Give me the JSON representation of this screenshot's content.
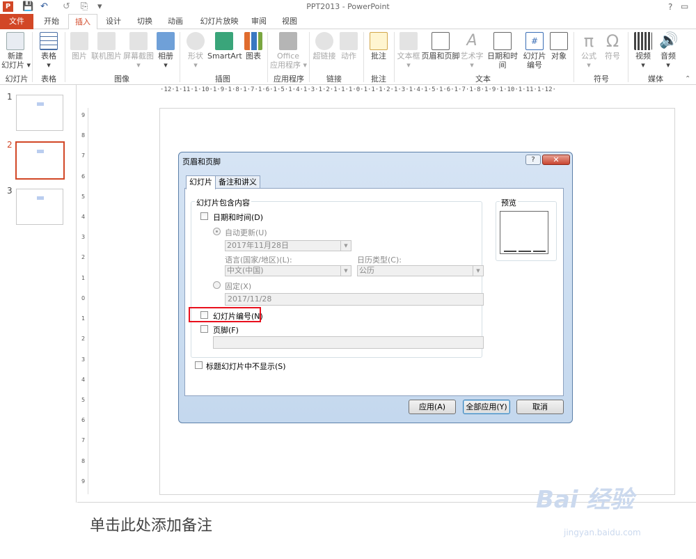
{
  "app": {
    "title": "PPT2013 - PowerPoint",
    "help": "?"
  },
  "qat": {
    "save": "💾",
    "undo": "↶",
    "redo": "↺",
    "more": "▾"
  },
  "tabs": [
    "文件",
    "开始",
    "插入",
    "设计",
    "切换",
    "动画",
    "幻灯片放映",
    "审阅",
    "视图"
  ],
  "ribbon": {
    "buttons": [
      {
        "label": "新建\n幻灯片 ▾",
        "disabled": false
      },
      {
        "label": "表格\n▾",
        "disabled": false
      },
      {
        "label": "图片",
        "disabled": true
      },
      {
        "label": "联机图片",
        "disabled": true
      },
      {
        "label": "屏幕截图\n▾",
        "disabled": true
      },
      {
        "label": "相册\n▾",
        "disabled": false
      },
      {
        "label": "形状\n▾",
        "disabled": true
      },
      {
        "label": "SmartArt",
        "disabled": false
      },
      {
        "label": "图表",
        "disabled": false
      },
      {
        "label": "Office\n应用程序 ▾",
        "disabled": true
      },
      {
        "label": "超链接",
        "disabled": true
      },
      {
        "label": "动作",
        "disabled": true
      },
      {
        "label": "批注",
        "disabled": false
      },
      {
        "label": "文本框\n▾",
        "disabled": true
      },
      {
        "label": "页眉和页脚",
        "disabled": false
      },
      {
        "label": "艺术字\n▾",
        "disabled": true
      },
      {
        "label": "日期和时间",
        "disabled": false
      },
      {
        "label": "幻灯片\n编号",
        "disabled": false
      },
      {
        "label": "对象",
        "disabled": false
      },
      {
        "label": "公式\n▾",
        "disabled": true
      },
      {
        "label": "符号",
        "disabled": true
      },
      {
        "label": "视频\n▾",
        "disabled": false
      },
      {
        "label": "音频\n▾",
        "disabled": false
      }
    ],
    "groups": [
      "幻灯片",
      "表格",
      "图像",
      "插图",
      "应用程序",
      "链接",
      "批注",
      "文本",
      "符号",
      "媒体"
    ]
  },
  "ruler": {
    "horizontal": "·12·1·11·1·10·1·9·1·8·1·7·1·6·1·5·1·4·1·3·1·2·1·1·1·0·1·1·1·2·1·3·1·4·1·5·1·6·1·7·1·8·1·9·1·10·1·11·1·12·",
    "vertical": [
      "9",
      "8",
      "7",
      "6",
      "5",
      "4",
      "3",
      "2",
      "1",
      "0",
      "1",
      "2",
      "3",
      "4",
      "5",
      "6",
      "7",
      "8",
      "9"
    ]
  },
  "slides": [
    {
      "num": "1"
    },
    {
      "num": "2"
    },
    {
      "num": "3"
    }
  ],
  "notes": {
    "placeholder": "单击此处添加备注"
  },
  "watermark": {
    "brand": "Bai 经验",
    "url": "jingyan.baidu.com"
  },
  "dialog": {
    "title": "页眉和页脚",
    "close": "✕",
    "tabs": [
      "幻灯片",
      "备注和讲义"
    ],
    "group_label": "幻灯片包含内容",
    "date_time": "日期和时间(D)",
    "auto_update": "自动更新(U)",
    "date_value": "2017年11月28日",
    "language_label": "语言(国家/地区)(L):",
    "language_value": "中文(中国)",
    "calendar_label": "日历类型(C):",
    "calendar_value": "公历",
    "fixed": "固定(X)",
    "fixed_value": "2017/11/28",
    "slide_number": "幻灯片编号(N)",
    "footer": "页脚(F)",
    "hide_title": "标题幻灯片中不显示(S)",
    "preview": "预览",
    "buttons": {
      "apply": "应用(A)",
      "apply_all": "全部应用(Y)",
      "cancel": "取消"
    }
  },
  "colors": {
    "accent": "#d24726",
    "highlight": "#e8101d"
  }
}
